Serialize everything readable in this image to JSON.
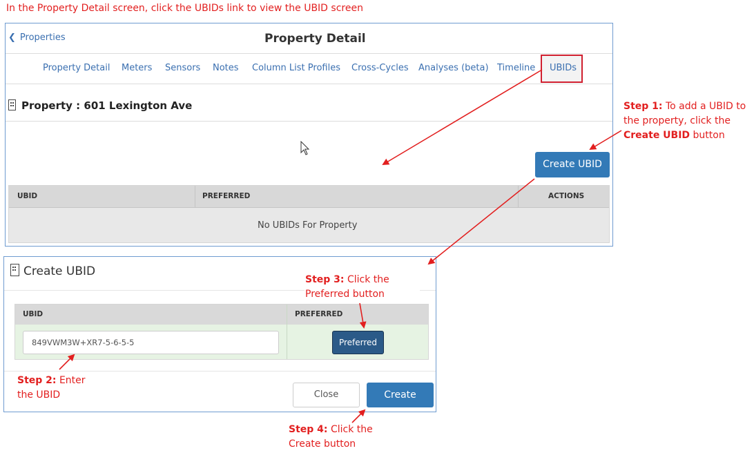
{
  "instruction_top": "In the Property Detail screen, click the UBIDs link to view the UBID screen",
  "header": {
    "back_label": "Properties",
    "title": "Property Detail"
  },
  "tabs": [
    {
      "label": "Property Detail"
    },
    {
      "label": "Meters"
    },
    {
      "label": "Sensors"
    },
    {
      "label": "Notes"
    },
    {
      "label": "Column List Profiles"
    },
    {
      "label": "Cross-Cycles"
    },
    {
      "label": "Analyses (beta)"
    },
    {
      "label": "Timeline"
    },
    {
      "label": "UBIDs",
      "active": true
    }
  ],
  "property": {
    "title": "Property : 601 Lexington Ave"
  },
  "create_ubid_button": "Create UBID",
  "ubid_table": {
    "columns": [
      "UBID",
      "PREFERRED",
      "ACTIONS"
    ],
    "empty_message": "No UBIDs For Property"
  },
  "modal": {
    "title": "Create UBID",
    "columns": [
      "UBID",
      "PREFERRED"
    ],
    "ubid_value": "849VWM3W+XR7-5-6-5-5",
    "preferred_label": "Preferred",
    "close_label": "Close",
    "create_label": "Create"
  },
  "steps": {
    "step1": {
      "label": "Step 1:",
      "text1": " To add a UBID to",
      "text2": "the property, click the",
      "bold": "Create UBID",
      "text3": " button"
    },
    "step2": {
      "label": "Step 2:",
      "text1": " Enter",
      "text2": "the UBID"
    },
    "step3": {
      "label": "Step 3:",
      "text1": " Click the",
      "text2": "Preferred button"
    },
    "step4": {
      "label": "Step 4:",
      "text1": " Click the",
      "text2": "Create button"
    }
  },
  "colors": {
    "annotation_red": "#e21f1f",
    "primary_blue": "#337ab7",
    "link_blue": "#3a6fb0",
    "panel_border": "#6e9bd0",
    "highlight_box": "#d01f2f"
  },
  "icons": [
    "chevron-left-icon",
    "building-icon",
    "cursor-icon",
    "arrow-icon"
  ]
}
